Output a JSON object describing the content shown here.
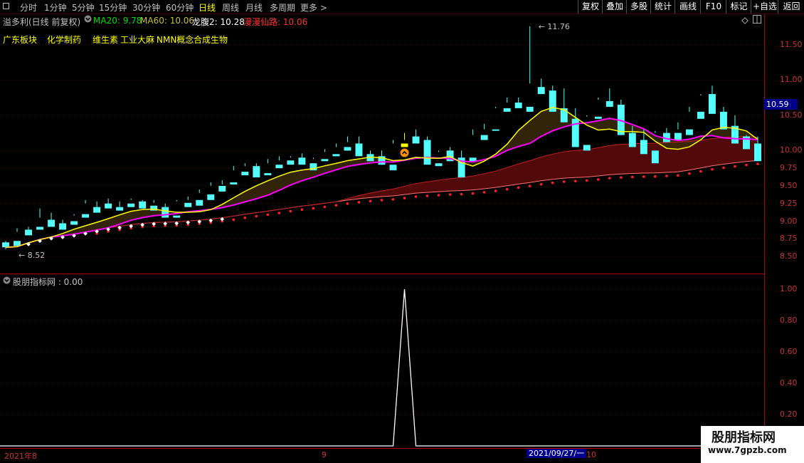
{
  "toolbar": {
    "periods": [
      "分时",
      "1分钟",
      "5分钟",
      "15分钟",
      "30分钟",
      "60分钟",
      "日线",
      "周线",
      "月线",
      "多周期",
      "更多 >"
    ],
    "active": "日线",
    "right_buttons": [
      "复权",
      "叠加",
      "多股",
      "统计",
      "画线",
      "F10",
      "标记",
      "+自选",
      "返回"
    ]
  },
  "stock": {
    "title": "溢多利(日线 前复权)",
    "ma20_label": "MA20: 9.78",
    "ma60_label": "MA60: 10.06",
    "longyin_label": "龙腹2: 10.28",
    "xianlu_label": "漫漫仙路: 10.06",
    "colors": {
      "ma20": "#00dd00",
      "ma60": "#c0c040",
      "longyin": "#ffffff",
      "xianlu": "#ff3030"
    }
  },
  "concepts": [
    "广东板块",
    "化学制药",
    "维生素",
    "工业大麻",
    "NMN概念",
    "合成生物"
  ],
  "main_axis": {
    "ticks": [
      "11.50",
      "11.00",
      "10.50",
      "10.00",
      "9.75",
      "9.50",
      "9.25",
      "9.00",
      "8.75",
      "8.50"
    ],
    "tick_values": [
      11.5,
      11.0,
      10.5,
      10.0,
      9.75,
      9.5,
      9.25,
      9.0,
      8.75,
      8.5
    ],
    "dummy": [
      "10.75",
      "10.25"
    ],
    "current_price": "10.59",
    "high_label": "11.76",
    "low_label": "8.52"
  },
  "indicator": {
    "title": "股朋指标网 : 0.00",
    "ticks": [
      "1.00",
      "0.80",
      "0.60",
      "0.40",
      "0.20"
    ]
  },
  "xaxis": {
    "labels": [
      "2021年8",
      "9",
      "10"
    ],
    "date_box": "2021/09/27/一"
  },
  "watermark": {
    "line1": "股朋指标网",
    "line2": "www.7gpzb.com"
  },
  "chart_data": {
    "type": "candlestick",
    "ylim": [
      8.4,
      11.85
    ],
    "candles": [
      [
        8.7,
        8.72,
        8.63,
        8.6
      ],
      [
        8.72,
        8.9,
        8.65,
        8.85
      ],
      [
        8.88,
        8.92,
        8.8,
        8.86
      ],
      [
        8.92,
        9.18,
        8.88,
        9.05
      ],
      [
        9.02,
        9.12,
        8.92,
        8.96
      ],
      [
        8.97,
        9.02,
        8.88,
        8.95
      ],
      [
        9.0,
        9.1,
        8.95,
        9.08
      ],
      [
        9.1,
        9.3,
        9.05,
        9.25
      ],
      [
        9.2,
        9.28,
        9.12,
        9.18
      ],
      [
        9.25,
        9.32,
        9.18,
        9.2
      ],
      [
        9.2,
        9.28,
        9.15,
        9.2
      ],
      [
        9.25,
        9.32,
        9.2,
        9.3
      ],
      [
        9.28,
        9.3,
        9.18,
        9.22
      ],
      [
        9.22,
        9.3,
        9.15,
        9.26
      ],
      [
        9.2,
        9.25,
        9.05,
        9.08
      ],
      [
        9.08,
        9.3,
        9.05,
        9.28
      ],
      [
        9.26,
        9.35,
        9.2,
        9.3
      ],
      [
        9.3,
        9.45,
        9.22,
        9.4
      ],
      [
        9.38,
        9.55,
        9.3,
        9.5
      ],
      [
        9.5,
        9.58,
        9.42,
        9.52
      ],
      [
        9.55,
        9.78,
        9.52,
        9.72
      ],
      [
        9.7,
        9.82,
        9.65,
        9.78
      ],
      [
        9.78,
        9.82,
        9.62,
        9.66
      ],
      [
        9.68,
        9.88,
        9.65,
        9.82
      ],
      [
        9.8,
        9.92,
        9.75,
        9.86
      ],
      [
        9.86,
        9.92,
        9.8,
        9.9
      ],
      [
        9.9,
        9.96,
        9.8,
        9.82
      ],
      [
        9.82,
        9.9,
        9.72,
        9.88
      ],
      [
        9.88,
        10.02,
        9.85,
        9.98
      ],
      [
        9.95,
        10.1,
        9.92,
        10.05
      ],
      [
        10.05,
        10.2,
        10.0,
        10.12
      ],
      [
        10.1,
        10.2,
        9.92,
        9.95
      ],
      [
        9.95,
        10.0,
        9.85,
        9.92
      ],
      [
        9.92,
        10.0,
        9.8,
        9.8
      ],
      [
        9.8,
        10.15,
        9.72,
        10.1
      ],
      [
        10.1,
        10.25,
        10.05,
        10.15
      ],
      [
        10.2,
        10.3,
        10.1,
        10.15
      ],
      [
        10.15,
        10.2,
        9.8,
        9.82
      ],
      [
        9.82,
        10.0,
        9.78,
        9.98
      ],
      [
        10.0,
        10.05,
        9.85,
        9.9
      ],
      [
        9.9,
        10.0,
        9.62,
        9.85
      ],
      [
        9.9,
        10.3,
        9.85,
        10.22
      ],
      [
        10.22,
        10.38,
        10.15,
        10.3
      ],
      [
        10.3,
        10.62,
        10.28,
        10.6
      ],
      [
        10.6,
        10.75,
        10.55,
        10.68
      ],
      [
        10.68,
        10.75,
        10.6,
        10.62
      ],
      [
        10.62,
        11.76,
        10.55,
        10.95
      ],
      [
        10.9,
        11.02,
        10.8,
        10.85
      ],
      [
        10.85,
        10.92,
        10.55,
        10.62
      ],
      [
        10.6,
        10.88,
        10.4,
        10.45
      ],
      [
        10.45,
        10.6,
        10.05,
        10.08
      ],
      [
        10.08,
        10.5,
        10.0,
        10.48
      ],
      [
        10.48,
        10.75,
        10.45,
        10.72
      ],
      [
        10.7,
        10.88,
        10.62,
        10.66
      ],
      [
        10.65,
        10.72,
        10.22,
        10.25
      ],
      [
        10.25,
        10.35,
        10.05,
        10.15
      ],
      [
        10.15,
        10.3,
        9.95,
        10.0
      ],
      [
        10.0,
        10.28,
        9.82,
        10.25
      ],
      [
        10.25,
        10.32,
        10.12,
        10.25
      ],
      [
        10.25,
        10.4,
        10.15,
        10.3
      ],
      [
        10.3,
        10.62,
        10.22,
        10.55
      ],
      [
        10.55,
        10.8,
        10.45,
        10.78
      ],
      [
        10.8,
        10.92,
        10.52,
        10.55
      ],
      [
        10.55,
        10.62,
        10.3,
        10.35
      ],
      [
        10.35,
        10.5,
        10.1,
        10.15
      ],
      [
        10.2,
        10.22,
        10.02,
        10.05
      ],
      [
        10.1,
        10.2,
        9.85,
        9.9
      ]
    ],
    "indicator_signal": {
      "x_index": 35,
      "value": 1.0
    }
  }
}
